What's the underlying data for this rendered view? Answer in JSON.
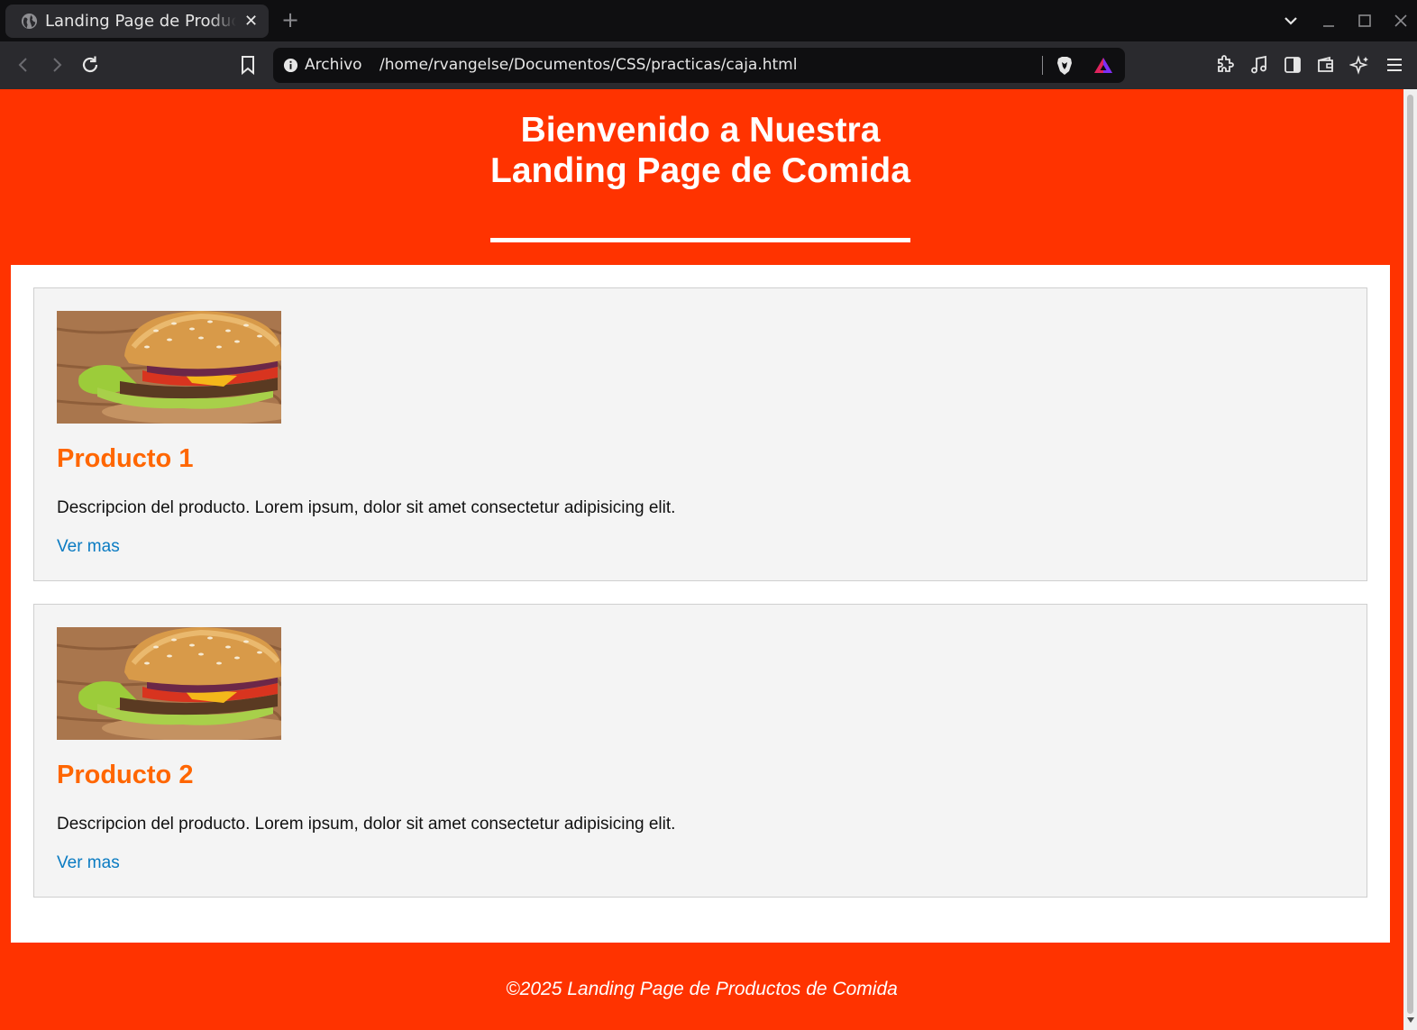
{
  "browser": {
    "tab_title": "Landing Page de Productos de Comida",
    "tab_close": "✕",
    "new_tab": "+",
    "url_label": "Archivo",
    "url": "/home/rvangelse/Documentos/CSS/practicas/caja.html"
  },
  "header": {
    "title": "Bienvenido a Nuestra Landing Page de Comida"
  },
  "products": [
    {
      "title": "Producto 1",
      "description": "Descripcion del producto. Lorem ipsum, dolor sit amet consectetur adipisicing elit.",
      "link": "Ver mas",
      "image": "burger-image"
    },
    {
      "title": "Producto 2",
      "description": "Descripcion del producto. Lorem ipsum, dolor sit amet consectetur adipisicing elit.",
      "link": "Ver mas",
      "image": "burger-image"
    }
  ],
  "footer": {
    "text": "©2025 Landing Page de Productos de Comida"
  },
  "colors": {
    "page_background": "#ff3300",
    "product_title": "#ff6600",
    "link": "#0a7bc2",
    "card_background": "#f4f4f4"
  }
}
